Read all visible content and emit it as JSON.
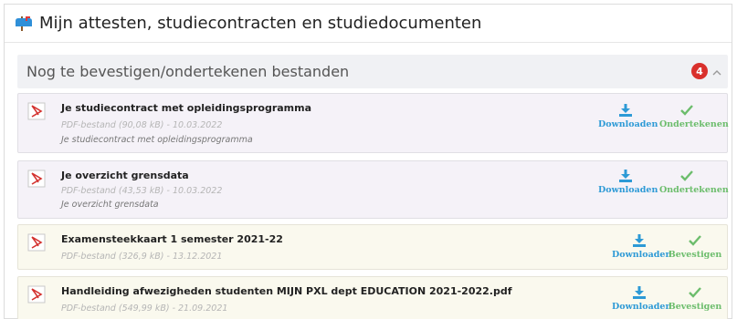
{
  "header": {
    "title": "Mijn attesten, studiecontracten en studiedocumenten"
  },
  "section": {
    "title": "Nog te bevestigen/ondertekenen bestanden",
    "badge_count": "4"
  },
  "items": [
    {
      "name": "Je studiecontract met opleidingsprogramma",
      "meta": "PDF-bestand (90,08 kB) - 10.03.2022",
      "description": "Je studiecontract met opleidingsprogramma",
      "download_label": "Downloaden",
      "action_label": "Ondertekenen"
    },
    {
      "name": "Je overzicht grensdata",
      "meta": "PDF-bestand (43,53 kB) - 10.03.2022",
      "description": "Je overzicht grensdata",
      "download_label": "Downloaden",
      "action_label": "Ondertekenen"
    },
    {
      "name": "Examensteekkaart 1 semester 2021-22",
      "meta": "PDF-bestand (326,9 kB) - 13.12.2021",
      "description": "",
      "download_label": "Downloaden",
      "action_label": "Bevestigen"
    },
    {
      "name": "Handleiding afwezigheden studenten MIJN PXL dept EDUCATION 2021-2022.pdf",
      "meta": "PDF-bestand (549,99 kB) - 21.09.2021",
      "description": "",
      "download_label": "Downloaden",
      "action_label": "Bevestigen"
    }
  ],
  "icons": {
    "header": "mailbox-icon",
    "file": "pdf-file-icon",
    "download": "download-icon",
    "confirm": "checkmark-icon",
    "collapse": "chevron-up-icon"
  },
  "colors": {
    "badge": "#d9302c",
    "download": "#2d9ad6",
    "confirm": "#6cbd6c",
    "pending_bg": "#f5f2f8",
    "confirm_bg": "#faf9ee"
  }
}
